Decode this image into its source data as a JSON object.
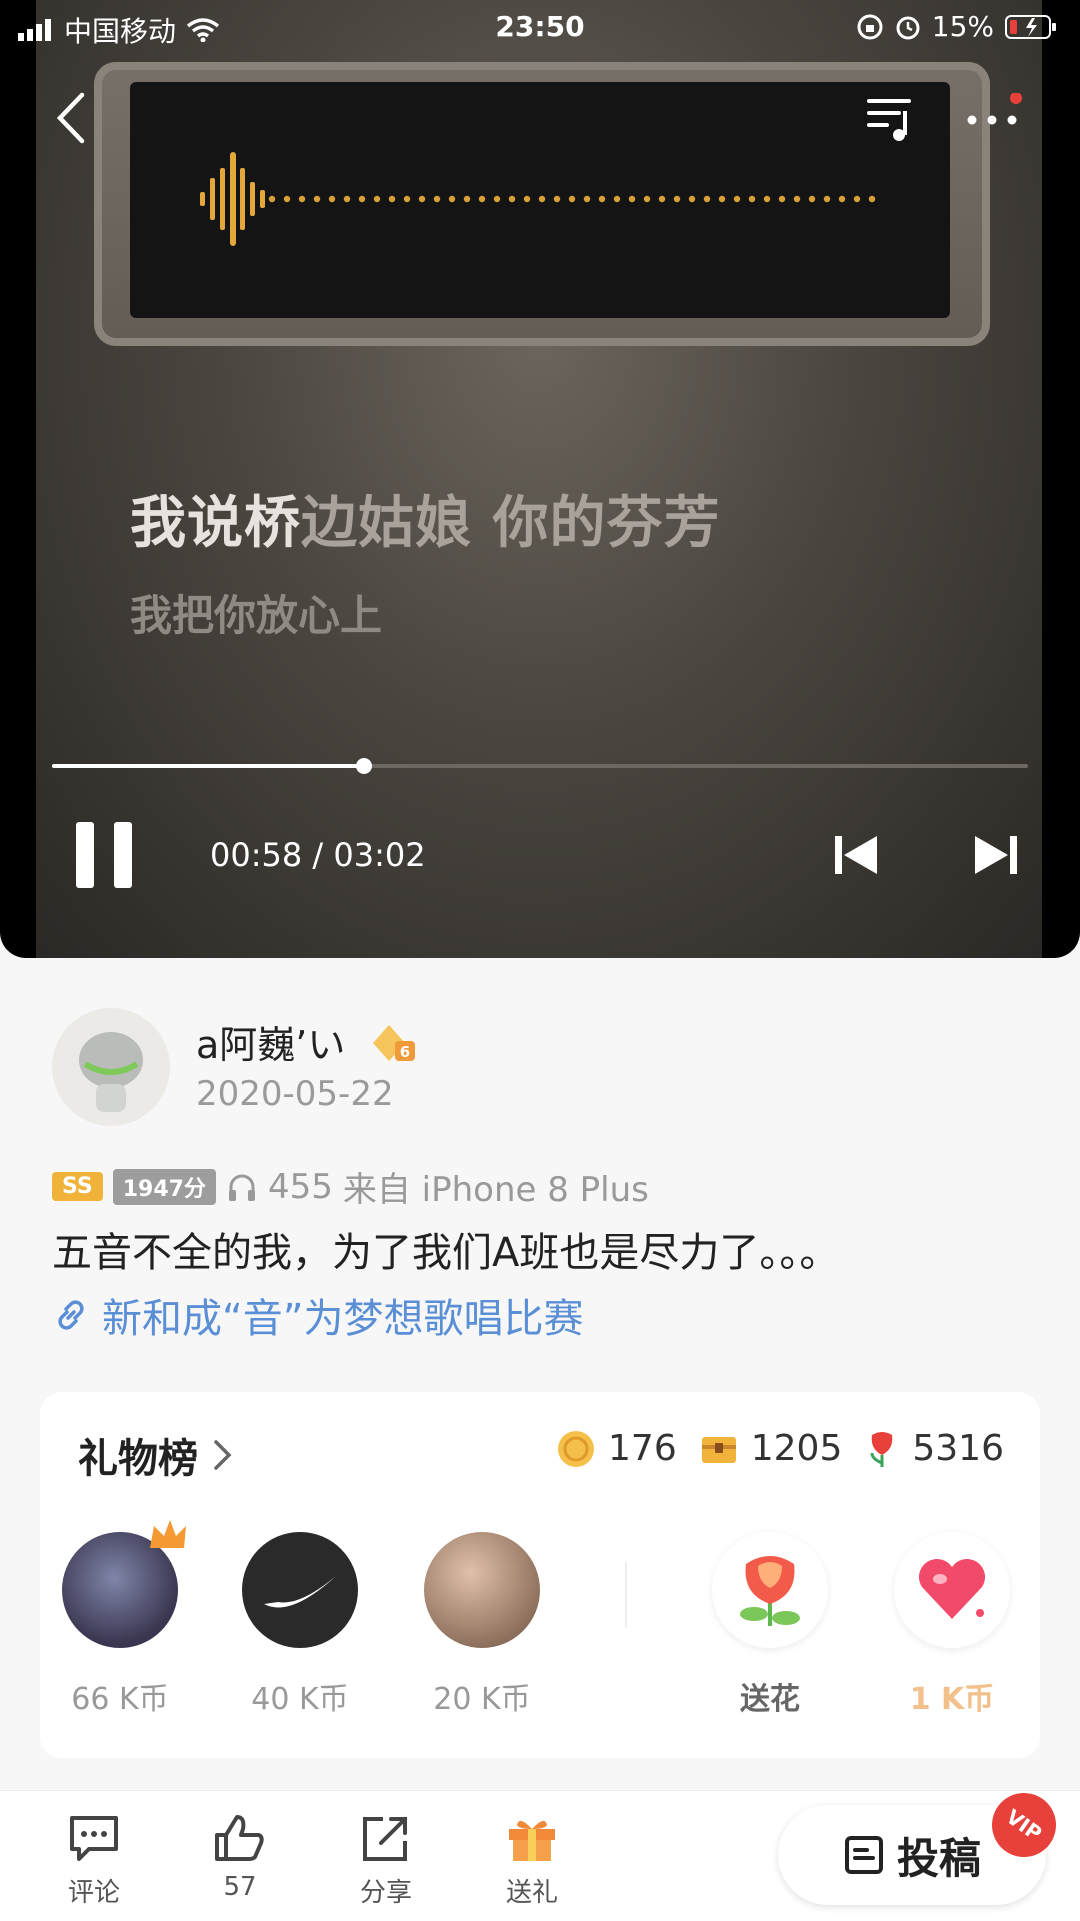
{
  "status_bar": {
    "carrier": "中国移动",
    "time": "23:50",
    "battery": "15%"
  },
  "player": {
    "lyric_current_sung": "我说桥",
    "lyric_current_rest": "边姑娘 你的芬芳",
    "lyric_next": "我把你放心上",
    "time_display": "00:58 / 03:02",
    "progress": 0.32
  },
  "post": {
    "username": "a阿巍ʼい",
    "level_badge": "6",
    "date": "2020-05-22",
    "grade": "SS",
    "score": "1947分",
    "plays": "455",
    "source": "来自 iPhone 8 Plus",
    "description": "五音不全的我，为了我们A班也是尽力了。。。",
    "link": "新和成“音”为梦想歌唱比赛"
  },
  "gifts": {
    "title": "礼物榜",
    "coin_count": "176",
    "chest_count": "1205",
    "flower_count": "5316",
    "givers": [
      {
        "label": "66 K币"
      },
      {
        "label": "40 K币"
      },
      {
        "label": "20 K币"
      }
    ],
    "actions": [
      {
        "label": "送花"
      },
      {
        "label": "1 K币"
      }
    ]
  },
  "bottom_bar": {
    "comment": "评论",
    "likes": "57",
    "share": "分享",
    "gift": "送礼",
    "post": "投稿",
    "vip": "VIP"
  },
  "colors": {
    "accent": "#f1b23a",
    "link": "#5a8fd6",
    "vip": "#e8413b"
  }
}
